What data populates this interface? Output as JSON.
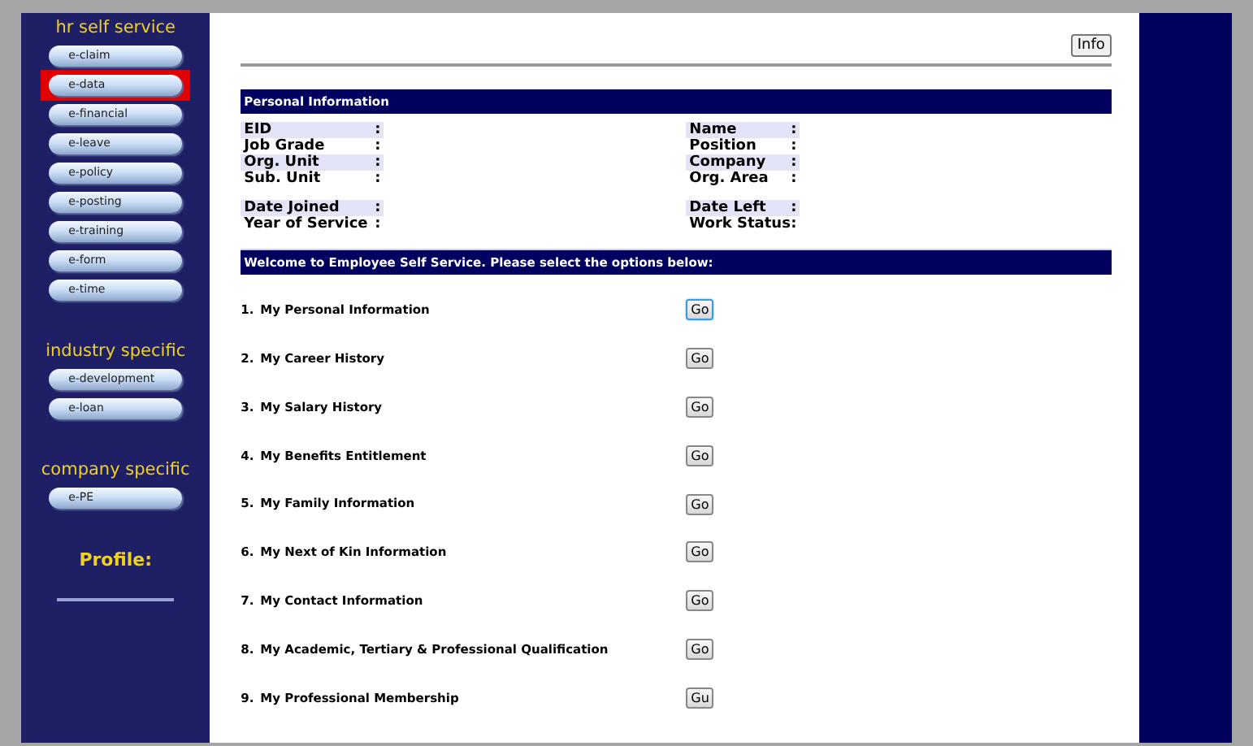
{
  "sidebar": {
    "sections": [
      {
        "title": "hr self service",
        "items": [
          {
            "label": "e-claim",
            "selected": false
          },
          {
            "label": "e-data",
            "selected": true
          },
          {
            "label": "e-financial",
            "selected": false
          },
          {
            "label": "e-leave",
            "selected": false
          },
          {
            "label": "e-policy",
            "selected": false
          },
          {
            "label": "e-posting",
            "selected": false
          },
          {
            "label": "e-training",
            "selected": false
          },
          {
            "label": "e-form",
            "selected": false
          },
          {
            "label": "e-time",
            "selected": false
          }
        ]
      },
      {
        "title": "industry specific",
        "items": [
          {
            "label": "e-development",
            "selected": false
          },
          {
            "label": "e-loan",
            "selected": false
          }
        ]
      },
      {
        "title": "company specific",
        "items": [
          {
            "label": "e-PE",
            "selected": false
          }
        ]
      }
    ],
    "profile": "Profile:"
  },
  "info_button": "Info",
  "personal_information": {
    "title": "Personal Information",
    "groups": [
      [
        {
          "left": "EID",
          "right": "Name"
        },
        {
          "left": "Job Grade",
          "right": "Position"
        },
        {
          "left": "Org. Unit",
          "right": "Company"
        },
        {
          "left": "Sub. Unit",
          "right": "Org. Area"
        }
      ],
      [
        {
          "left": "Date Joined",
          "right": "Date Left"
        },
        {
          "left": "Year of Service",
          "right": "Work Status"
        }
      ]
    ],
    "separator": ":"
  },
  "welcome": {
    "title": "Welcome to Employee Self Service. Please select the options below:",
    "options": [
      {
        "number": "1.",
        "label": "My Personal Information",
        "button": "Go",
        "focused": true
      },
      {
        "number": "2.",
        "label": "My Career History",
        "button": "Go",
        "focused": false
      },
      {
        "number": "3.",
        "label": "My Salary History",
        "button": "Go",
        "focused": false
      },
      {
        "number": "4.",
        "label": "My Benefits Entitlement",
        "button": "Go",
        "focused": false
      },
      {
        "number": "5.",
        "label": "My Family Information",
        "button": "Go",
        "focused": false
      },
      {
        "number": "6.",
        "label": "My Next of Kin Information",
        "button": "Go",
        "focused": false
      },
      {
        "number": "7.",
        "label": "My Contact Information",
        "button": "Go",
        "focused": false
      },
      {
        "number": "8.",
        "label": "My Academic, Tertiary & Professional Qualification",
        "button": "Go",
        "focused": false
      },
      {
        "number": "9.",
        "label": "My Professional Membership",
        "button": "Gu",
        "focused": false
      }
    ]
  }
}
